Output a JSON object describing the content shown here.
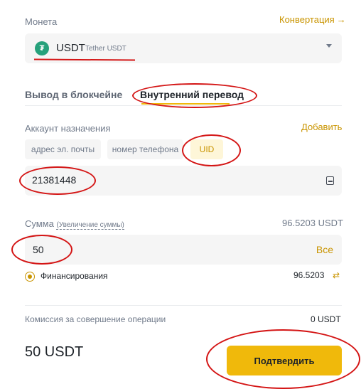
{
  "coin": {
    "label": "Монета",
    "convert_link": "Конвертация",
    "convert_arrow": "→",
    "symbol": "USDT",
    "name": "Tether USDT",
    "icon_glyph": "₮",
    "icon_color": "#26a17b"
  },
  "tabs": [
    {
      "label": "Вывод в блокчейне",
      "active": false
    },
    {
      "label": "Внутренний перевод",
      "active": true
    }
  ],
  "destination": {
    "label": "Аккаунт назначения",
    "add_link": "Добавить",
    "options": [
      {
        "label": "адрес эл. почты",
        "selected": false
      },
      {
        "label": "номер телефона",
        "selected": false
      },
      {
        "label": "UID",
        "selected": true
      }
    ],
    "value": "21381448"
  },
  "amount": {
    "label": "Сумма",
    "increase_link": "(Увеличение суммы)",
    "available": "96.5203 USDT",
    "value": "50",
    "max_label": "Все"
  },
  "funding": {
    "label": "Финансирования",
    "amount": "96.5203",
    "swap_glyph": "⇄"
  },
  "fee": {
    "label": "Комиссия за совершение операции",
    "value": "0 USDT"
  },
  "total": "50 USDT",
  "confirm_label": "Подтвердить",
  "colors": {
    "accent": "#f0b90b",
    "accent_text": "#c99400",
    "annotation": "#d41515"
  }
}
